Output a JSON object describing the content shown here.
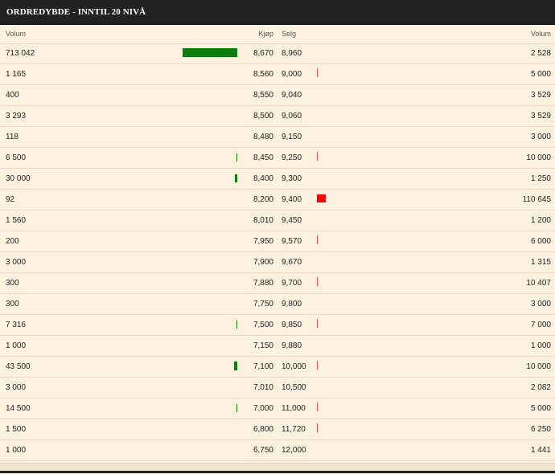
{
  "panel": {
    "title": "ORDREDYBDE - INNTIL 20 NIVÅ"
  },
  "headers": {
    "buy_volume": "Volum",
    "buy_price": "Kjøp",
    "sell_price": "Selg",
    "sell_volume": "Volum"
  },
  "colors": {
    "buy_bar": "#0a7f10",
    "sell_bar": "#ff0000",
    "title_bg": "#222222",
    "row_bg": "#fdf1df"
  },
  "rows": [
    {
      "buy_volume": "713 042",
      "buy_price": "8,670",
      "sell_price": "8,960",
      "sell_volume": "2 528"
    },
    {
      "buy_volume": "1 165",
      "buy_price": "8,560",
      "sell_price": "9,000",
      "sell_volume": "5 000"
    },
    {
      "buy_volume": "400",
      "buy_price": "8,550",
      "sell_price": "9,040",
      "sell_volume": "3 529"
    },
    {
      "buy_volume": "3 293",
      "buy_price": "8,500",
      "sell_price": "9,060",
      "sell_volume": "3 529"
    },
    {
      "buy_volume": "118",
      "buy_price": "8,480",
      "sell_price": "9,150",
      "sell_volume": "3 000"
    },
    {
      "buy_volume": "6 500",
      "buy_price": "8,450",
      "sell_price": "9,250",
      "sell_volume": "10 000"
    },
    {
      "buy_volume": "30 000",
      "buy_price": "8,400",
      "sell_price": "9,300",
      "sell_volume": "1 250"
    },
    {
      "buy_volume": "92",
      "buy_price": "8,200",
      "sell_price": "9,400",
      "sell_volume": "110 645"
    },
    {
      "buy_volume": "1 560",
      "buy_price": "8,010",
      "sell_price": "9,450",
      "sell_volume": "1 200"
    },
    {
      "buy_volume": "200",
      "buy_price": "7,950",
      "sell_price": "9,570",
      "sell_volume": "6 000"
    },
    {
      "buy_volume": "3 000",
      "buy_price": "7,900",
      "sell_price": "9,670",
      "sell_volume": "1 315"
    },
    {
      "buy_volume": "300",
      "buy_price": "7,880",
      "sell_price": "9,700",
      "sell_volume": "10 407"
    },
    {
      "buy_volume": "300",
      "buy_price": "7,750",
      "sell_price": "9,800",
      "sell_volume": "3 000"
    },
    {
      "buy_volume": "7 316",
      "buy_price": "7,500",
      "sell_price": "9,850",
      "sell_volume": "7 000"
    },
    {
      "buy_volume": "1 000",
      "buy_price": "7,150",
      "sell_price": "9,880",
      "sell_volume": "1 000"
    },
    {
      "buy_volume": "43 500",
      "buy_price": "7,100",
      "sell_price": "10,000",
      "sell_volume": "10 000"
    },
    {
      "buy_volume": "3 000",
      "buy_price": "7,010",
      "sell_price": "10,500",
      "sell_volume": "2 082"
    },
    {
      "buy_volume": "14 500",
      "buy_price": "7,000",
      "sell_price": "11,000",
      "sell_volume": "5 000"
    },
    {
      "buy_volume": "1 500",
      "buy_price": "6,800",
      "sell_price": "11,720",
      "sell_volume": "6 250"
    },
    {
      "buy_volume": "1 000",
      "buy_price": "6,750",
      "sell_price": "12,000",
      "sell_volume": "1 441"
    }
  ]
}
